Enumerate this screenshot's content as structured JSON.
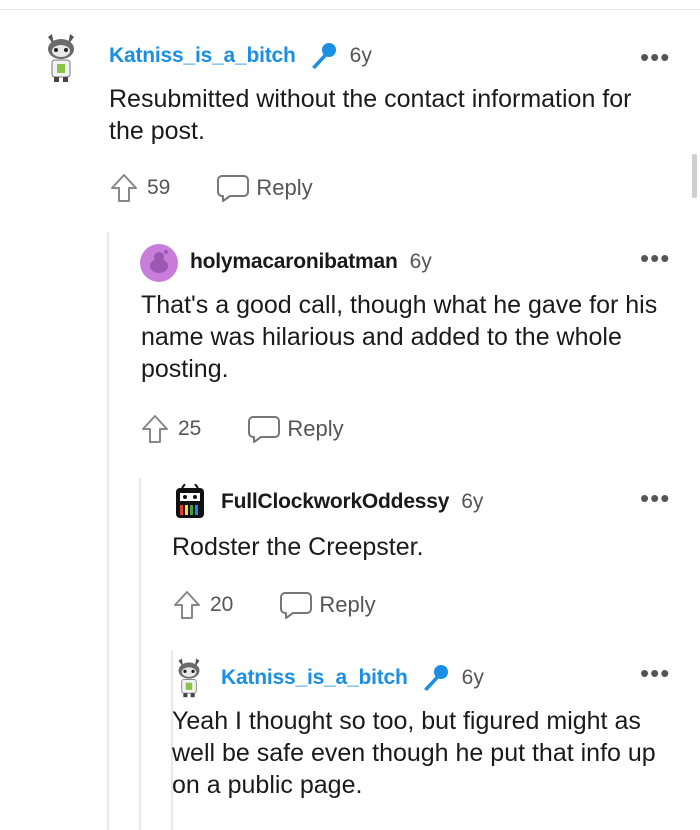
{
  "comments": [
    {
      "username": "Katniss_is_a_bitch",
      "age": "6y",
      "body": "Resubmitted without the contact information for the post.",
      "votes": "59",
      "reply_label": "Reply",
      "more": "•••",
      "has_mic_badge": true,
      "avatar_icon": "snoo-kitty-avatar-icon"
    },
    {
      "username": "holymacaronibatman",
      "age": "6y",
      "body": "That's a good call, though what he gave for his name was hilarious and added to the whole posting.",
      "votes": "25",
      "reply_label": "Reply",
      "more": "•••",
      "has_mic_badge": false,
      "avatar_icon": "purple-snoo-avatar-icon"
    },
    {
      "username": "FullClockworkOddessy",
      "age": "6y",
      "body": "Rodster the Creepster.",
      "votes": "20",
      "reply_label": "Reply",
      "more": "•••",
      "has_mic_badge": false,
      "avatar_icon": "robot-avatar-icon"
    },
    {
      "username": "Katniss_is_a_bitch",
      "age": "6y",
      "body": "Yeah I thought so too, but figured might as well be safe even though he put that info up on a public page.",
      "votes": "",
      "reply_label": "",
      "more": "•••",
      "has_mic_badge": true,
      "avatar_icon": "snoo-kitty-avatar-icon"
    }
  ],
  "colors": {
    "username_highlight": "#1a8fe3",
    "text": "#1a1a1b",
    "meta": "#555555",
    "thread_line": "#e9e9e9"
  }
}
